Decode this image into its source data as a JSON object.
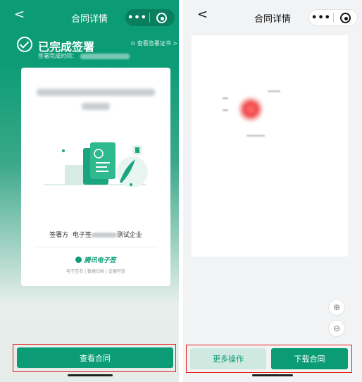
{
  "left": {
    "header": {
      "back": "<",
      "title": "合同详情",
      "more": "•••"
    },
    "status": {
      "text": "已完成签署",
      "cert_link": "⊙ 查看签署证书 >",
      "time_label": "签署完成时间："
    },
    "card": {
      "signer_prefix": "签署方",
      "signer_company_start": "电子签",
      "signer_company_end": "测试企业",
      "brand": "腾讯电子签",
      "brand_sub": "电子签名 | 数据归档 | 证据可查"
    },
    "view_button": "查看合同"
  },
  "right": {
    "header": {
      "back": "<",
      "title": "合同详情",
      "more": "•••"
    },
    "zoom_in": "⊕",
    "zoom_out": "⊖",
    "more_actions_button": "更多操作",
    "download_button": "下载合同"
  },
  "colors": {
    "brand_green": "#0b9c76",
    "light_green": "#cfe9e0",
    "highlight_red": "#e02020"
  },
  "icons": [
    "back-icon",
    "more-icon",
    "close-ring-icon",
    "check-circle-icon",
    "contract-illustration",
    "seal-stamp",
    "zoom-in-icon",
    "zoom-out-icon"
  ]
}
